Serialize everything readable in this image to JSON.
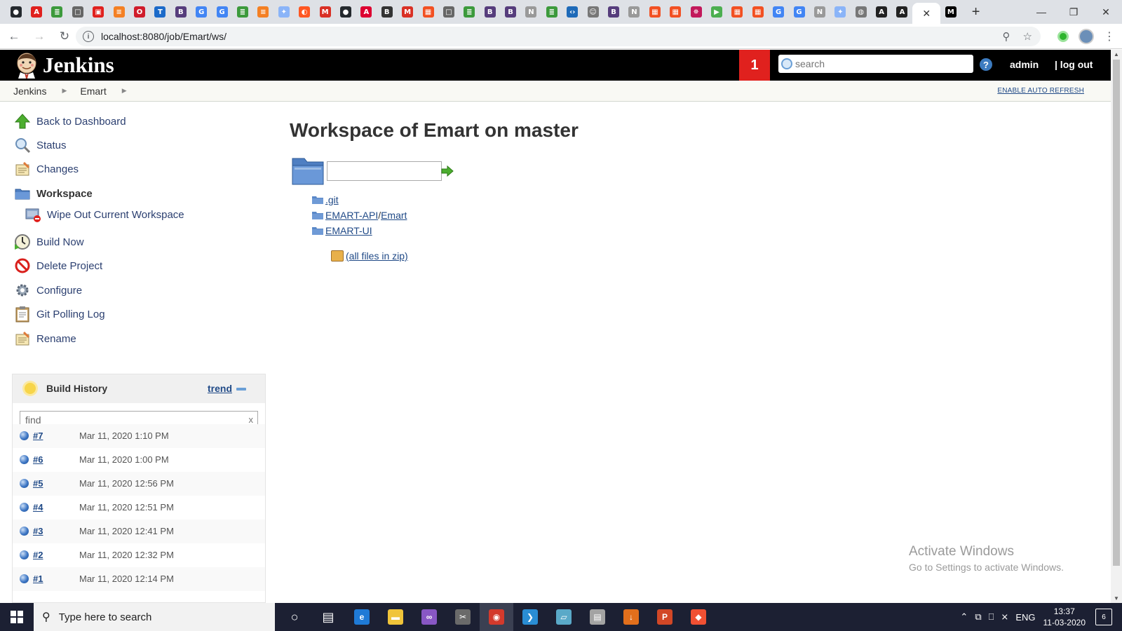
{
  "browser": {
    "url": "localhost:8080/job/Emart/ws/",
    "window_buttons": [
      "—",
      "❐",
      "✕"
    ],
    "tab_close": "✕",
    "new_tab": "+",
    "tab_favicons": [
      {
        "icon": "github-icon",
        "glyph": "●",
        "color": "#24292e"
      },
      {
        "icon": "pdf-icon",
        "glyph": "A",
        "color": "#e0211e"
      },
      {
        "icon": "sheet-icon",
        "glyph": "≣",
        "color": "#3c9a3c"
      },
      {
        "icon": "chat-icon",
        "glyph": "□",
        "color": "#666666"
      },
      {
        "icon": "app-icon",
        "glyph": "▣",
        "color": "#e0211e"
      },
      {
        "icon": "stack-icon",
        "glyph": "≡",
        "color": "#f48024"
      },
      {
        "icon": "opera-icon",
        "glyph": "O",
        "color": "#d01c2b"
      },
      {
        "icon": "t-icon",
        "glyph": "T",
        "color": "#1b6ac9"
      },
      {
        "icon": "b-icon",
        "glyph": "B",
        "color": "#563d7c"
      },
      {
        "icon": "google-icon",
        "glyph": "G",
        "color": "#4285f4"
      },
      {
        "icon": "google-icon",
        "glyph": "G",
        "color": "#4285f4"
      },
      {
        "icon": "sheet-icon",
        "glyph": "≣",
        "color": "#3c9a3c"
      },
      {
        "icon": "stack-icon",
        "glyph": "≡",
        "color": "#f48024"
      },
      {
        "icon": "star-icon",
        "glyph": "✦",
        "color": "#8ab4f8"
      },
      {
        "icon": "circle-icon",
        "glyph": "◐",
        "color": "#ff5722"
      },
      {
        "icon": "gmail-icon",
        "glyph": "M",
        "color": "#d93025"
      },
      {
        "icon": "github-icon",
        "glyph": "●",
        "color": "#24292e"
      },
      {
        "icon": "angular-icon",
        "glyph": "A",
        "color": "#dd0031"
      },
      {
        "icon": "b-icon",
        "glyph": "B",
        "color": "#333333"
      },
      {
        "icon": "gmail-icon",
        "glyph": "M",
        "color": "#d93025"
      },
      {
        "icon": "ms-icon",
        "glyph": "▦",
        "color": "#f25022"
      },
      {
        "icon": "chat-icon",
        "glyph": "□",
        "color": "#666666"
      },
      {
        "icon": "sheet-icon",
        "glyph": "≣",
        "color": "#3c9a3c"
      },
      {
        "icon": "b-icon",
        "glyph": "B",
        "color": "#563d7c"
      },
      {
        "icon": "b-icon",
        "glyph": "B",
        "color": "#563d7c"
      },
      {
        "icon": "ne-icon",
        "glyph": "N",
        "color": "#999999"
      },
      {
        "icon": "sheet-icon",
        "glyph": "≣",
        "color": "#3c9a3c"
      },
      {
        "icon": "code-icon",
        "glyph": "‹›",
        "color": "#1e6ab8"
      },
      {
        "icon": "user-icon",
        "glyph": "☺",
        "color": "#777777"
      },
      {
        "icon": "b-icon",
        "glyph": "B",
        "color": "#563d7c"
      },
      {
        "icon": "ne-icon",
        "glyph": "N",
        "color": "#999999"
      },
      {
        "icon": "ms-icon",
        "glyph": "▦",
        "color": "#f25022"
      },
      {
        "icon": "ms-icon",
        "glyph": "▦",
        "color": "#f25022"
      },
      {
        "icon": "bug-icon",
        "glyph": "✵",
        "color": "#c2185b"
      },
      {
        "icon": "play-icon",
        "glyph": "▶",
        "color": "#4caf50"
      },
      {
        "icon": "ms-icon",
        "glyph": "▦",
        "color": "#f25022"
      },
      {
        "icon": "ms-icon",
        "glyph": "▦",
        "color": "#f25022"
      },
      {
        "icon": "google-icon",
        "glyph": "G",
        "color": "#4285f4"
      },
      {
        "icon": "google-icon",
        "glyph": "G",
        "color": "#4285f4"
      },
      {
        "icon": "ne-icon",
        "glyph": "N",
        "color": "#999999"
      },
      {
        "icon": "star-icon",
        "glyph": "✦",
        "color": "#8ab4f8"
      },
      {
        "icon": "globe-icon",
        "glyph": "◍",
        "color": "#777777"
      },
      {
        "icon": "angular-icon",
        "glyph": "A",
        "color": "#222222"
      },
      {
        "icon": "angular-icon",
        "glyph": "A",
        "color": "#222222"
      }
    ],
    "active_tab_favicon": {
      "icon": "medium-icon",
      "glyph": "M",
      "color": "#000000"
    }
  },
  "jenkins": {
    "title": "Jenkins",
    "notification_count": "1",
    "search_placeholder": "search",
    "help": "?",
    "user": "admin",
    "logout": "| log out",
    "breadcrumbs": [
      "Jenkins",
      "Emart"
    ],
    "auto_refresh": "ENABLE AUTO REFRESH"
  },
  "sidebar": {
    "tasks": [
      {
        "label": "Back to Dashboard",
        "icon": "up-arrow-icon"
      },
      {
        "label": "Status",
        "icon": "magnifier-icon"
      },
      {
        "label": "Changes",
        "icon": "notepad-icon"
      },
      {
        "label": "Workspace",
        "icon": "folder-icon",
        "active": true
      },
      {
        "label": "Wipe Out Current Workspace",
        "icon": "wipe-workspace-icon",
        "sub": true
      },
      {
        "label": "Build Now",
        "icon": "clock-icon"
      },
      {
        "label": "Delete Project",
        "icon": "no-entry-icon"
      },
      {
        "label": "Configure",
        "icon": "gear-icon"
      },
      {
        "label": "Git Polling Log",
        "icon": "clipboard-icon"
      },
      {
        "label": "Rename",
        "icon": "notepad-icon"
      }
    ]
  },
  "build_history": {
    "title": "Build History",
    "trend": "trend",
    "find_placeholder": "find",
    "clear": "x",
    "builds": [
      {
        "num": "#7",
        "date": "Mar 11, 2020 1:10 PM"
      },
      {
        "num": "#6",
        "date": "Mar 11, 2020 1:00 PM"
      },
      {
        "num": "#5",
        "date": "Mar 11, 2020 12:56 PM"
      },
      {
        "num": "#4",
        "date": "Mar 11, 2020 12:51 PM"
      },
      {
        "num": "#3",
        "date": "Mar 11, 2020 12:41 PM"
      },
      {
        "num": "#2",
        "date": "Mar 11, 2020 12:32 PM"
      },
      {
        "num": "#1",
        "date": "Mar 11, 2020 12:14 PM"
      }
    ]
  },
  "main": {
    "title": "Workspace of Emart on master",
    "entries": [
      {
        "parts": [
          ".git"
        ]
      },
      {
        "parts": [
          "EMART-API",
          "Emart"
        ],
        "separator": "/"
      },
      {
        "parts": [
          "EMART-UI"
        ]
      }
    ],
    "zip_link": "(all files in zip)"
  },
  "watermark": {
    "line1": "Activate Windows",
    "line2": "Go to Settings to activate Windows."
  },
  "taskbar": {
    "search_placeholder": "Type here to search",
    "apps": [
      {
        "icon": "cortana-icon",
        "glyph": "○",
        "color": "transparent"
      },
      {
        "icon": "task-view-icon",
        "glyph": "▤",
        "color": "transparent"
      },
      {
        "icon": "edge-icon",
        "glyph": "e",
        "color": "#1f7ad6"
      },
      {
        "icon": "file-explorer-icon",
        "glyph": "▬",
        "color": "#f0c43a"
      },
      {
        "icon": "visual-studio-icon",
        "glyph": "∞",
        "color": "#8857c4"
      },
      {
        "icon": "snipping-icon",
        "glyph": "✂",
        "color": "#6a6a6a"
      },
      {
        "icon": "chrome-icon",
        "glyph": "◉",
        "color": "#d33a2c",
        "active": true
      },
      {
        "icon": "vscode-icon",
        "glyph": "❯",
        "color": "#2a8dd4"
      },
      {
        "icon": "notes-icon",
        "glyph": "▱",
        "color": "#5aa9c8"
      },
      {
        "icon": "sql-icon",
        "glyph": "▤",
        "color": "#a3a3a3"
      },
      {
        "icon": "downloader-icon",
        "glyph": "↓",
        "color": "#e26f1c"
      },
      {
        "icon": "powerpoint-icon",
        "glyph": "P",
        "color": "#d24726"
      },
      {
        "icon": "git-icon",
        "glyph": "◆",
        "color": "#f05033"
      }
    ],
    "tray_symbols": [
      "⌃",
      "⧉",
      "⎕",
      "⨯"
    ],
    "language": "ENG",
    "time": "13:37",
    "date": "11-03-2020",
    "notifications": "6"
  }
}
